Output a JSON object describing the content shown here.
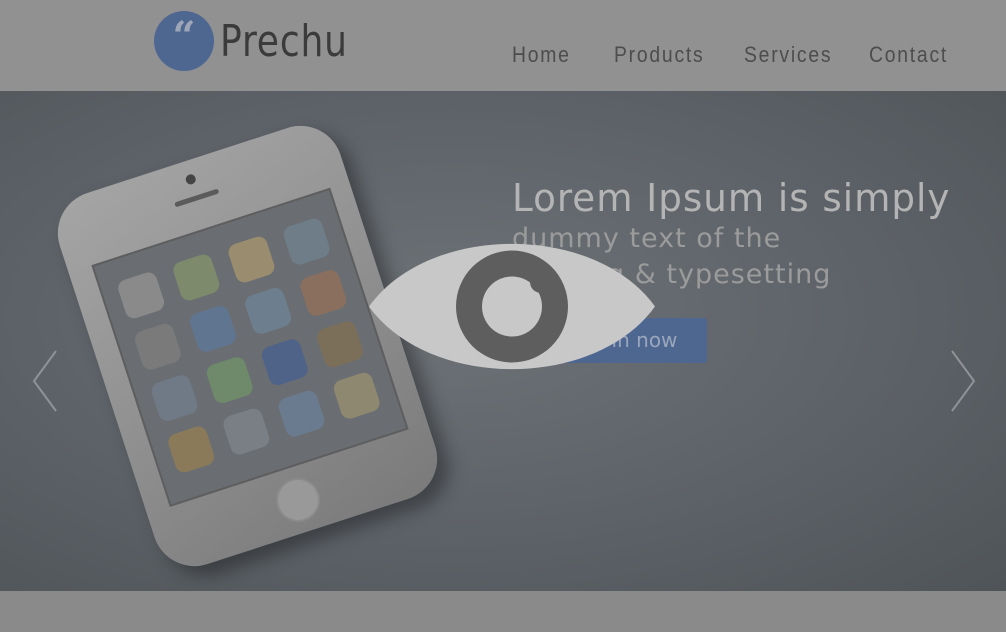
{
  "header": {
    "logo_glyph": "“",
    "brand": "Prechu",
    "nav": [
      {
        "label": "Home"
      },
      {
        "label": "Products"
      },
      {
        "label": "Services"
      },
      {
        "label": "Contact"
      }
    ]
  },
  "hero": {
    "title": "Lorem Ipsum is simply",
    "subtitle_line1": "dummy text of the",
    "subtitle_line2": "printing & typesetting",
    "button_label": "Sign in now",
    "prev_icon": "chevron-left-icon",
    "next_icon": "chevron-right-icon"
  },
  "overlay": {
    "icon": "eye-icon"
  },
  "colors": {
    "accent": "#4e6791",
    "header_bg": "#919191",
    "footer_bg": "#8a8a8a"
  }
}
